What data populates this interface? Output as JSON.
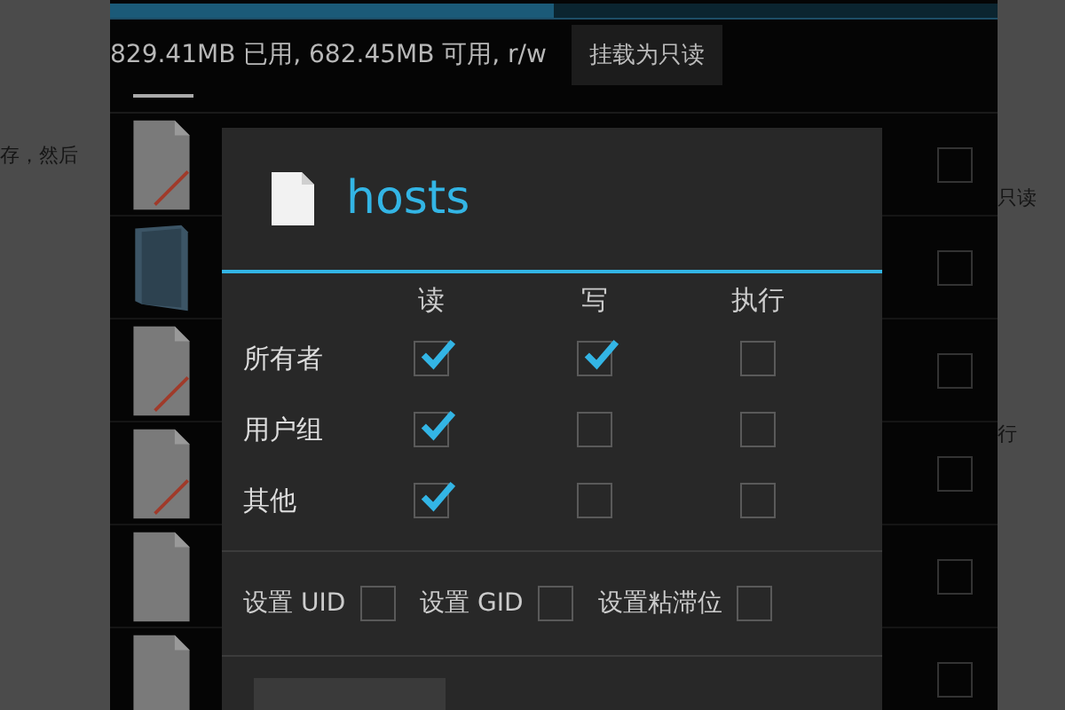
{
  "progress": {
    "level": 0.5
  },
  "storage": {
    "text": "829.41MB 已用, 682.45MB 可用, r/w",
    "button": "挂载为只读"
  },
  "background_text": {
    "left": "存，然后",
    "right_1": "只读",
    "right_2": "行"
  },
  "files": [
    {
      "kind": "edit",
      "checked": false
    },
    {
      "kind": "folder",
      "checked": false
    },
    {
      "kind": "edit",
      "checked": false
    },
    {
      "kind": "edit",
      "checked": false
    },
    {
      "kind": "plain",
      "checked": false
    },
    {
      "kind": "plain",
      "checked": false
    }
  ],
  "dialog": {
    "title": "hosts",
    "columns": [
      "读",
      "写",
      "执行"
    ],
    "rows": [
      {
        "label": "所有者",
        "read": true,
        "write": true,
        "execute": false
      },
      {
        "label": "用户组",
        "read": true,
        "write": false,
        "execute": false
      },
      {
        "label": "其他",
        "read": true,
        "write": false,
        "execute": false
      }
    ],
    "special": [
      {
        "label": "设置 UID",
        "checked": false
      },
      {
        "label": "设置 GID",
        "checked": false
      },
      {
        "label": "设置粘滞位",
        "checked": false
      }
    ]
  }
}
